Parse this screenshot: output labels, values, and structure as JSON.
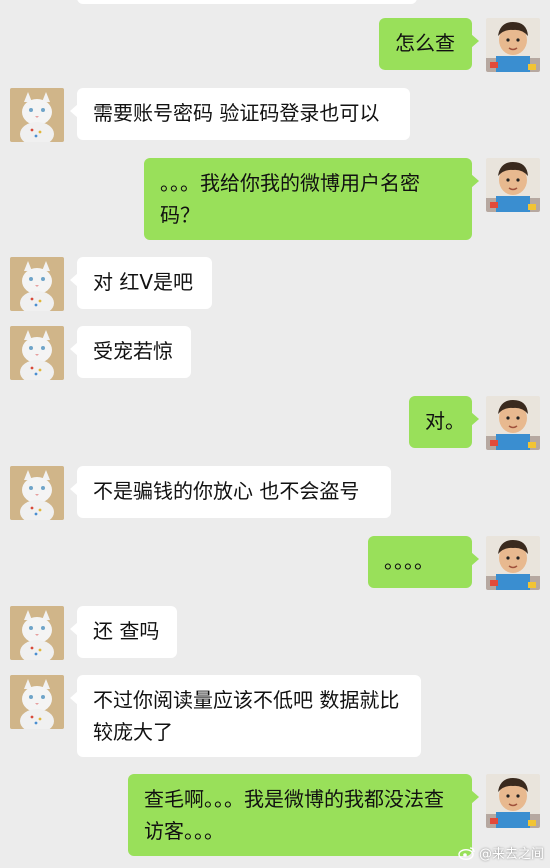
{
  "colors": {
    "background": "#ececec",
    "incoming_bubble": "#ffffff",
    "outgoing_bubble": "#99e05a"
  },
  "messages": [
    {
      "side": "out",
      "avatar": "boy-avatar",
      "text": "怎么查"
    },
    {
      "side": "in",
      "avatar": "cat-avatar",
      "text": "需要账号密码 验证码登录也可以"
    },
    {
      "side": "out",
      "avatar": "boy-avatar",
      "text": "。。。我给你我的微博用户名密码？"
    },
    {
      "side": "in",
      "avatar": "cat-avatar",
      "text": "对 红V是吧"
    },
    {
      "side": "in",
      "avatar": "cat-avatar",
      "text": "受宠若惊"
    },
    {
      "side": "out",
      "avatar": "boy-avatar",
      "text": "对。"
    },
    {
      "side": "in",
      "avatar": "cat-avatar",
      "text": "不是骗钱的你放心 也不会盗号"
    },
    {
      "side": "out",
      "avatar": "boy-avatar",
      "text": "。。。。"
    },
    {
      "side": "in",
      "avatar": "cat-avatar",
      "text": "还 查吗"
    },
    {
      "side": "in",
      "avatar": "cat-avatar",
      "text": "不过你阅读量应该不低吧 数据就比较庞大了"
    },
    {
      "side": "out",
      "avatar": "boy-avatar",
      "text": "查毛啊。。。我是微博的我都没法查访客。。。"
    }
  ],
  "watermark": {
    "text": "@来去之间",
    "icon": "weibo-icon"
  }
}
